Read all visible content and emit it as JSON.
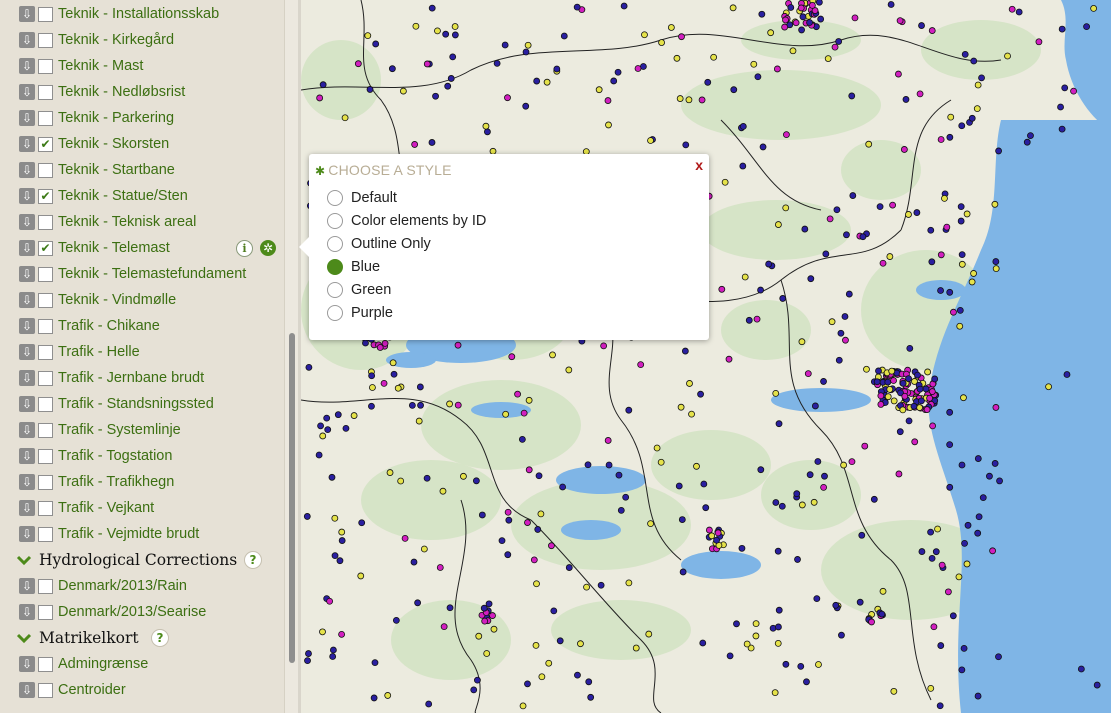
{
  "sidebar": {
    "layers": [
      {
        "label": "Teknik - Installationsskab",
        "checked": false
      },
      {
        "label": "Teknik - Kirkegård",
        "checked": false
      },
      {
        "label": "Teknik - Mast",
        "checked": false
      },
      {
        "label": "Teknik - Nedløbsrist",
        "checked": false
      },
      {
        "label": "Teknik - Parkering",
        "checked": false
      },
      {
        "label": "Teknik - Skorsten",
        "checked": true
      },
      {
        "label": "Teknik - Startbane",
        "checked": false
      },
      {
        "label": "Teknik - Statue/Sten",
        "checked": true
      },
      {
        "label": "Teknik - Teknisk areal",
        "checked": false
      },
      {
        "label": "Teknik - Telemast",
        "checked": true
      },
      {
        "label": "Teknik - Telemastefundament",
        "checked": false
      },
      {
        "label": "Teknik - Vindmølle",
        "checked": false
      },
      {
        "label": "Trafik - Chikane",
        "checked": false
      },
      {
        "label": "Trafik - Helle",
        "checked": false
      },
      {
        "label": "Trafik - Jernbane brudt",
        "checked": false
      },
      {
        "label": "Trafik - Standsningssted",
        "checked": false
      },
      {
        "label": "Trafik - Systemlinje",
        "checked": false
      },
      {
        "label": "Trafik - Togstation",
        "checked": false
      },
      {
        "label": "Trafik - Trafikhegn",
        "checked": false
      },
      {
        "label": "Trafik - Vejkant",
        "checked": false
      },
      {
        "label": "Trafik - Vejmidte brudt",
        "checked": false
      }
    ],
    "groups": [
      {
        "title": "Hydrological Corrections",
        "layers": [
          {
            "label": "Denmark/2013/Rain",
            "checked": false
          },
          {
            "label": "Denmark/2013/Searise",
            "checked": false
          }
        ]
      },
      {
        "title": "Matrikelkort",
        "layers": [
          {
            "label": "Admingrænse",
            "checked": false
          },
          {
            "label": "Centroider",
            "checked": false
          }
        ]
      }
    ],
    "icons": {
      "download": "download-arrow-icon",
      "info": "info-icon",
      "settings": "gear-icon",
      "help": "question-icon",
      "expand": "chevron-down-icon"
    },
    "check_mark": "✔",
    "download_glyph": "⇩",
    "help_glyph": "?",
    "info_glyph": "i",
    "gear_glyph": "✲",
    "chevron_glyph": "⌄"
  },
  "popup": {
    "title": "CHOOSE A STYLE",
    "close_label": "x",
    "gear_glyph": "✱",
    "options": [
      {
        "label": "Default",
        "selected": false
      },
      {
        "label": "Color elements by ID",
        "selected": false
      },
      {
        "label": "Outline Only",
        "selected": false
      },
      {
        "label": "Blue",
        "selected": true
      },
      {
        "label": "Green",
        "selected": false
      },
      {
        "label": "Purple",
        "selected": false
      }
    ]
  },
  "colors": {
    "accent_green": "#4d8a1a",
    "label_green": "#3c6f12",
    "sea": "#7fb5e6",
    "land": "#ecebdf",
    "forest": "#cfe2bf",
    "lake": "#7fb5e6",
    "point_blue": "#2a1fa0",
    "point_magenta": "#d21fc0",
    "point_yellow": "#e5e24a"
  }
}
